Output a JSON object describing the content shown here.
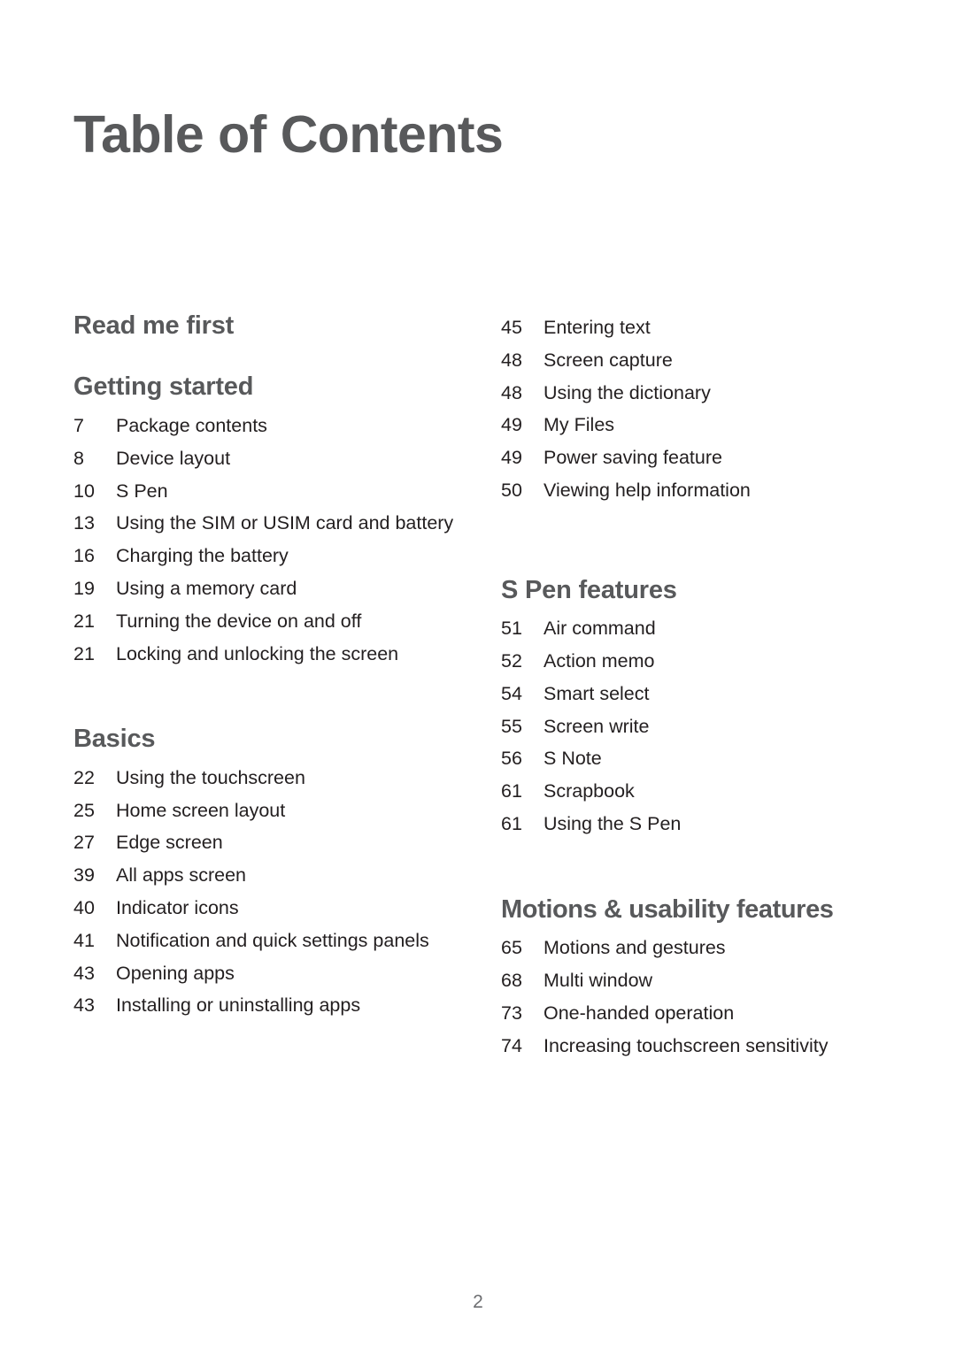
{
  "document": {
    "title": "Table of Contents",
    "page_number": "2"
  },
  "colors": {
    "heading": "#58595b",
    "body": "#231f20",
    "folio": "#6d6e71",
    "background": "#ffffff"
  },
  "left_column": {
    "sections": [
      {
        "heading": "Read me first",
        "entries": []
      },
      {
        "heading": "Getting started",
        "entries": [
          {
            "page": "7",
            "label": "Package contents"
          },
          {
            "page": "8",
            "label": "Device layout"
          },
          {
            "page": "10",
            "label": "S Pen"
          },
          {
            "page": "13",
            "label": "Using the SIM or USIM card and battery"
          },
          {
            "page": "16",
            "label": "Charging the battery"
          },
          {
            "page": "19",
            "label": "Using a memory card"
          },
          {
            "page": "21",
            "label": "Turning the device on and off"
          },
          {
            "page": "21",
            "label": "Locking and unlocking the screen"
          }
        ]
      },
      {
        "heading": "Basics",
        "entries": [
          {
            "page": "22",
            "label": "Using the touchscreen"
          },
          {
            "page": "25",
            "label": "Home screen layout"
          },
          {
            "page": "27",
            "label": "Edge screen"
          },
          {
            "page": "39",
            "label": "All apps screen"
          },
          {
            "page": "40",
            "label": "Indicator icons"
          },
          {
            "page": "41",
            "label": "Notification and quick settings panels"
          },
          {
            "page": "43",
            "label": "Opening apps"
          },
          {
            "page": "43",
            "label": "Installing or uninstalling apps"
          }
        ]
      }
    ]
  },
  "right_column": {
    "sections": [
      {
        "heading": "",
        "entries": [
          {
            "page": "45",
            "label": "Entering text"
          },
          {
            "page": "48",
            "label": "Screen capture"
          },
          {
            "page": "48",
            "label": "Using the dictionary"
          },
          {
            "page": "49",
            "label": "My Files"
          },
          {
            "page": "49",
            "label": "Power saving feature"
          },
          {
            "page": "50",
            "label": "Viewing help information"
          }
        ]
      },
      {
        "heading": "S Pen features",
        "entries": [
          {
            "page": "51",
            "label": "Air command"
          },
          {
            "page": "52",
            "label": "Action memo"
          },
          {
            "page": "54",
            "label": "Smart select"
          },
          {
            "page": "55",
            "label": "Screen write"
          },
          {
            "page": "56",
            "label": "S Note"
          },
          {
            "page": "61",
            "label": "Scrapbook"
          },
          {
            "page": "61",
            "label": "Using the S Pen"
          }
        ]
      },
      {
        "heading": "Motions & usability features",
        "entries": [
          {
            "page": "65",
            "label": "Motions and gestures"
          },
          {
            "page": "68",
            "label": "Multi window"
          },
          {
            "page": "73",
            "label": "One-handed operation"
          },
          {
            "page": "74",
            "label": "Increasing touchscreen sensitivity"
          }
        ]
      }
    ]
  }
}
